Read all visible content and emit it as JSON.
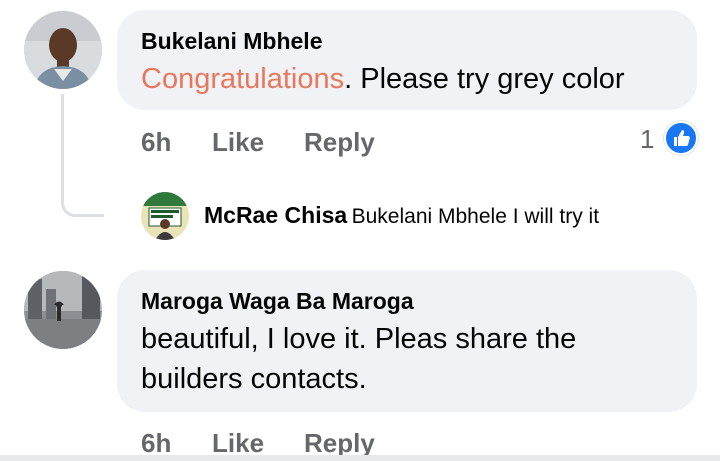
{
  "comments": [
    {
      "author": "Bukelani Mbhele",
      "text_highlight": "Congratulations",
      "text_rest": ". Please try grey color",
      "time": "6h",
      "like_label": "Like",
      "reply_label": "Reply",
      "reaction_count": "1",
      "reaction_icon": "thumbs-up-icon"
    },
    {
      "author": "Maroga Waga Ba Maroga",
      "text_line1": "beautiful, I love it. Pleas share the",
      "text_line2": "builders contacts.",
      "time": "6h",
      "like_label": "Like",
      "reply_label": "Reply"
    }
  ],
  "reply": {
    "author": "McRae Chisa",
    "mention": "Bukelani Mbhele",
    "text": " I will try it"
  },
  "colors": {
    "bubble": "#f0f2f5",
    "highlight": "#e9775b",
    "meta": "#65676b",
    "like_blue": "#1877f2"
  }
}
